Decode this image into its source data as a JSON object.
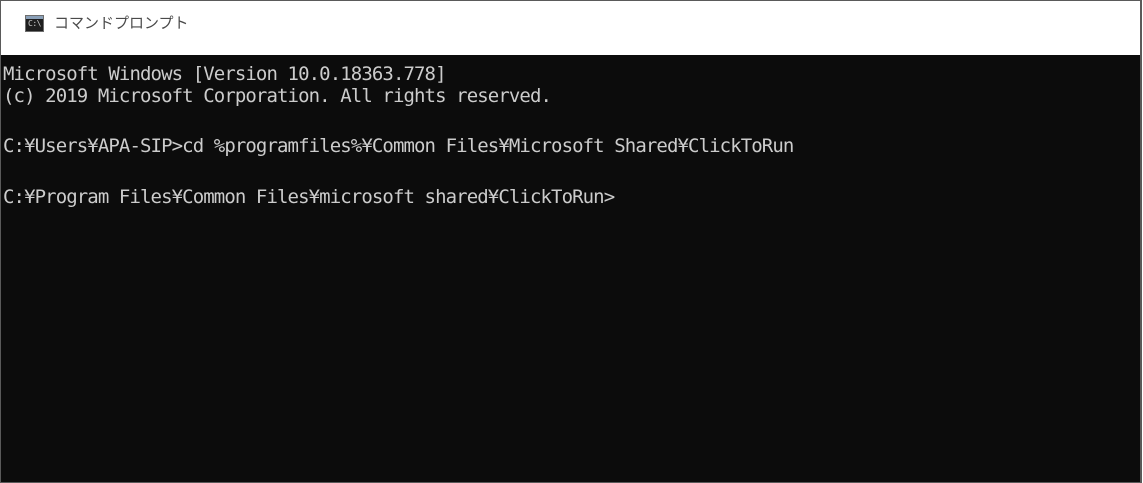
{
  "window": {
    "title": "コマンドプロンプト",
    "icon": "console-icon",
    "icon_glyph": "C:\\"
  },
  "console": {
    "lines": [
      "Microsoft Windows [Version 10.0.18363.778]",
      "(c) 2019 Microsoft Corporation. All rights reserved.",
      "C:¥Users¥APA-SIP>cd %programfiles%¥Common Files¥Microsoft Shared¥ClickToRun",
      "C:¥Program Files¥Common Files¥microsoft shared¥ClickToRun>"
    ]
  },
  "colors": {
    "console_background": "#0c0c0c",
    "console_text": "#cccccc",
    "titlebar_background": "#ffffff",
    "title_text": "#4a4a4a"
  }
}
